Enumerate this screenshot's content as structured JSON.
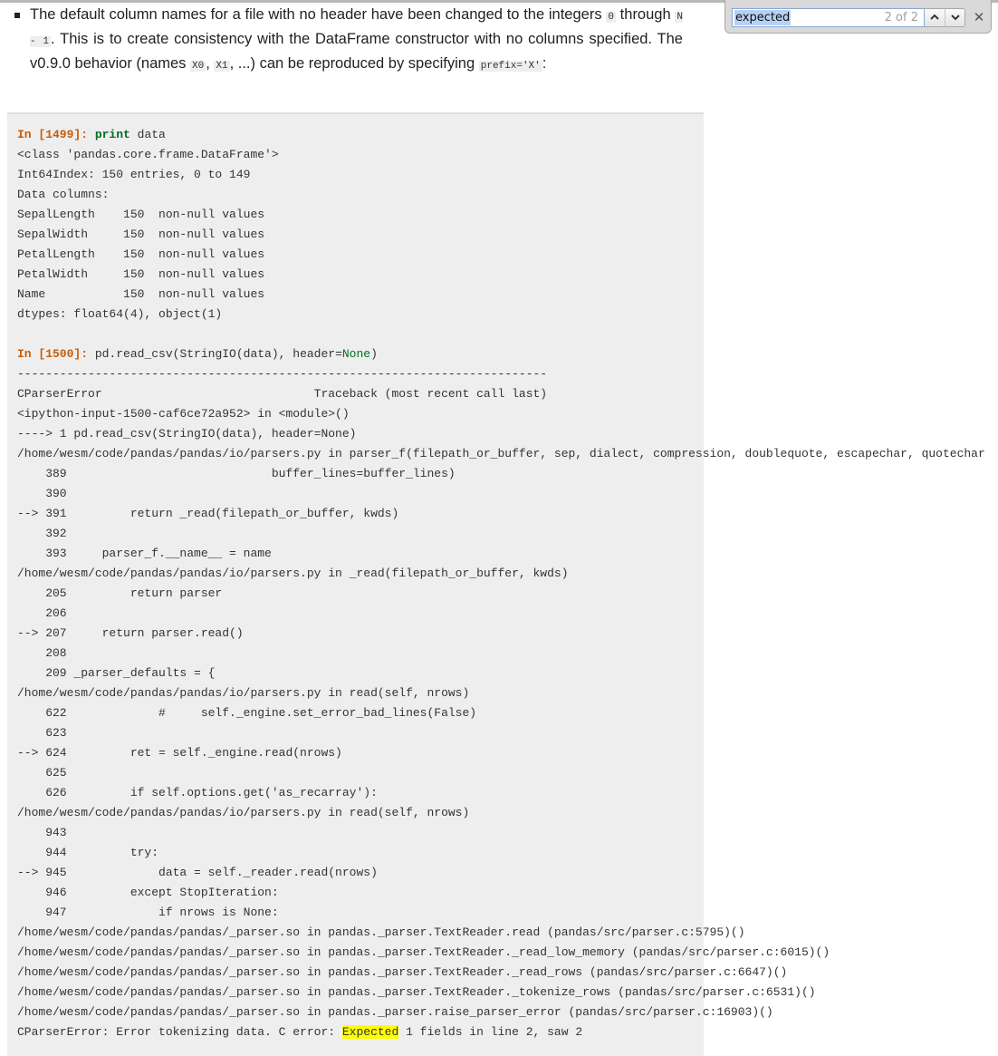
{
  "doc": {
    "bullet_paragraph": [
      {
        "t": "text",
        "v": "The default column names for a file with no header have been changed to the integers "
      },
      {
        "t": "code",
        "v": "0"
      },
      {
        "t": "text",
        "v": " through "
      },
      {
        "t": "code",
        "v": "N - 1"
      },
      {
        "t": "text",
        "v": ". This is to create consistency with the DataFrame constructor with no columns specified. The v0.9.0 behavior (names "
      },
      {
        "t": "code",
        "v": "X0"
      },
      {
        "t": "text",
        "v": ", "
      },
      {
        "t": "code",
        "v": "X1"
      },
      {
        "t": "text",
        "v": ", ...) can be reproduced by specifying "
      },
      {
        "t": "code",
        "v": "prefix='X'"
      },
      {
        "t": "text",
        "v": ":"
      }
    ]
  },
  "code_block": {
    "lines": [
      [
        {
          "c": "prompt",
          "v": "In [1499]: "
        },
        {
          "c": "kw",
          "v": "print"
        },
        {
          "c": "",
          "v": " data"
        }
      ],
      [
        {
          "c": "",
          "v": "<class 'pandas.core.frame.DataFrame'>"
        }
      ],
      [
        {
          "c": "",
          "v": "Int64Index: 150 entries, 0 to 149"
        }
      ],
      [
        {
          "c": "",
          "v": "Data columns:"
        }
      ],
      [
        {
          "c": "",
          "v": "SepalLength    150  non-null values"
        }
      ],
      [
        {
          "c": "",
          "v": "SepalWidth     150  non-null values"
        }
      ],
      [
        {
          "c": "",
          "v": "PetalLength    150  non-null values"
        }
      ],
      [
        {
          "c": "",
          "v": "PetalWidth     150  non-null values"
        }
      ],
      [
        {
          "c": "",
          "v": "Name           150  non-null values"
        }
      ],
      [
        {
          "c": "",
          "v": "dtypes: float64(4), object(1)"
        }
      ],
      [
        {
          "c": "",
          "v": ""
        }
      ],
      [
        {
          "c": "prompt",
          "v": "In [1500]: "
        },
        {
          "c": "",
          "v": "pd.read_csv(StringIO(data), header="
        },
        {
          "c": "nm",
          "v": "None"
        },
        {
          "c": "",
          "v": ")"
        }
      ],
      [
        {
          "c": "",
          "v": "---------------------------------------------------------------------------"
        }
      ],
      [
        {
          "c": "",
          "v": "CParserError                              Traceback (most recent call last)"
        }
      ],
      [
        {
          "c": "",
          "v": "<ipython-input-1500-caf6ce72a952> in <module>()"
        }
      ],
      [
        {
          "c": "",
          "v": "----> 1 pd.read_csv(StringIO(data), header=None)"
        }
      ],
      [
        {
          "c": "",
          "v": "/home/wesm/code/pandas/pandas/io/parsers.py in parser_f(filepath_or_buffer, sep, dialect, compression, doublequote, escapechar, quotechar"
        }
      ],
      [
        {
          "c": "",
          "v": "    389                             buffer_lines=buffer_lines)"
        }
      ],
      [
        {
          "c": "",
          "v": "    390"
        }
      ],
      [
        {
          "c": "",
          "v": "--> 391         return _read(filepath_or_buffer, kwds)"
        }
      ],
      [
        {
          "c": "",
          "v": "    392"
        }
      ],
      [
        {
          "c": "",
          "v": "    393     parser_f.__name__ = name"
        }
      ],
      [
        {
          "c": "",
          "v": "/home/wesm/code/pandas/pandas/io/parsers.py in _read(filepath_or_buffer, kwds)"
        }
      ],
      [
        {
          "c": "",
          "v": "    205         return parser"
        }
      ],
      [
        {
          "c": "",
          "v": "    206"
        }
      ],
      [
        {
          "c": "",
          "v": "--> 207     return parser.read()"
        }
      ],
      [
        {
          "c": "",
          "v": "    208"
        }
      ],
      [
        {
          "c": "",
          "v": "    209 _parser_defaults = {"
        }
      ],
      [
        {
          "c": "",
          "v": "/home/wesm/code/pandas/pandas/io/parsers.py in read(self, nrows)"
        }
      ],
      [
        {
          "c": "",
          "v": "    622             #     self._engine.set_error_bad_lines(False)"
        }
      ],
      [
        {
          "c": "",
          "v": "    623"
        }
      ],
      [
        {
          "c": "",
          "v": "--> 624         ret = self._engine.read(nrows)"
        }
      ],
      [
        {
          "c": "",
          "v": "    625"
        }
      ],
      [
        {
          "c": "",
          "v": "    626         if self.options.get('as_recarray'):"
        }
      ],
      [
        {
          "c": "",
          "v": "/home/wesm/code/pandas/pandas/io/parsers.py in read(self, nrows)"
        }
      ],
      [
        {
          "c": "",
          "v": "    943"
        }
      ],
      [
        {
          "c": "",
          "v": "    944         try:"
        }
      ],
      [
        {
          "c": "",
          "v": "--> 945             data = self._reader.read(nrows)"
        }
      ],
      [
        {
          "c": "",
          "v": "    946         except StopIteration:"
        }
      ],
      [
        {
          "c": "",
          "v": "    947             if nrows is None:"
        }
      ],
      [
        {
          "c": "",
          "v": "/home/wesm/code/pandas/pandas/_parser.so in pandas._parser.TextReader.read (pandas/src/parser.c:5795)()"
        }
      ],
      [
        {
          "c": "",
          "v": "/home/wesm/code/pandas/pandas/_parser.so in pandas._parser.TextReader._read_low_memory (pandas/src/parser.c:6015)()"
        }
      ],
      [
        {
          "c": "",
          "v": "/home/wesm/code/pandas/pandas/_parser.so in pandas._parser.TextReader._read_rows (pandas/src/parser.c:6647)()"
        }
      ],
      [
        {
          "c": "",
          "v": "/home/wesm/code/pandas/pandas/_parser.so in pandas._parser.TextReader._tokenize_rows (pandas/src/parser.c:6531)()"
        }
      ],
      [
        {
          "c": "",
          "v": "/home/wesm/code/pandas/pandas/_parser.so in pandas._parser.raise_parser_error (pandas/src/parser.c:16903)()"
        }
      ],
      [
        {
          "c": "",
          "v": "CParserError: Error tokenizing data. C error: "
        },
        {
          "c": "hl",
          "v": "Expected"
        },
        {
          "c": "",
          "v": " 1 fields in line 2, saw 2"
        }
      ]
    ]
  },
  "find_bar": {
    "query": "expected",
    "match_count": "2 of 2",
    "prev_icon": "chevron-up-icon",
    "prev_glyph": "⌃",
    "next_icon": "chevron-down-icon",
    "next_glyph": "⌄",
    "close_icon": "close-icon",
    "close_glyph": "✕"
  },
  "colors": {
    "prompt": "#c65d09",
    "keyword": "#007020",
    "code_background": "#eeeeee",
    "find_highlight": "#ffff00",
    "selection": "#b7d1f5"
  }
}
